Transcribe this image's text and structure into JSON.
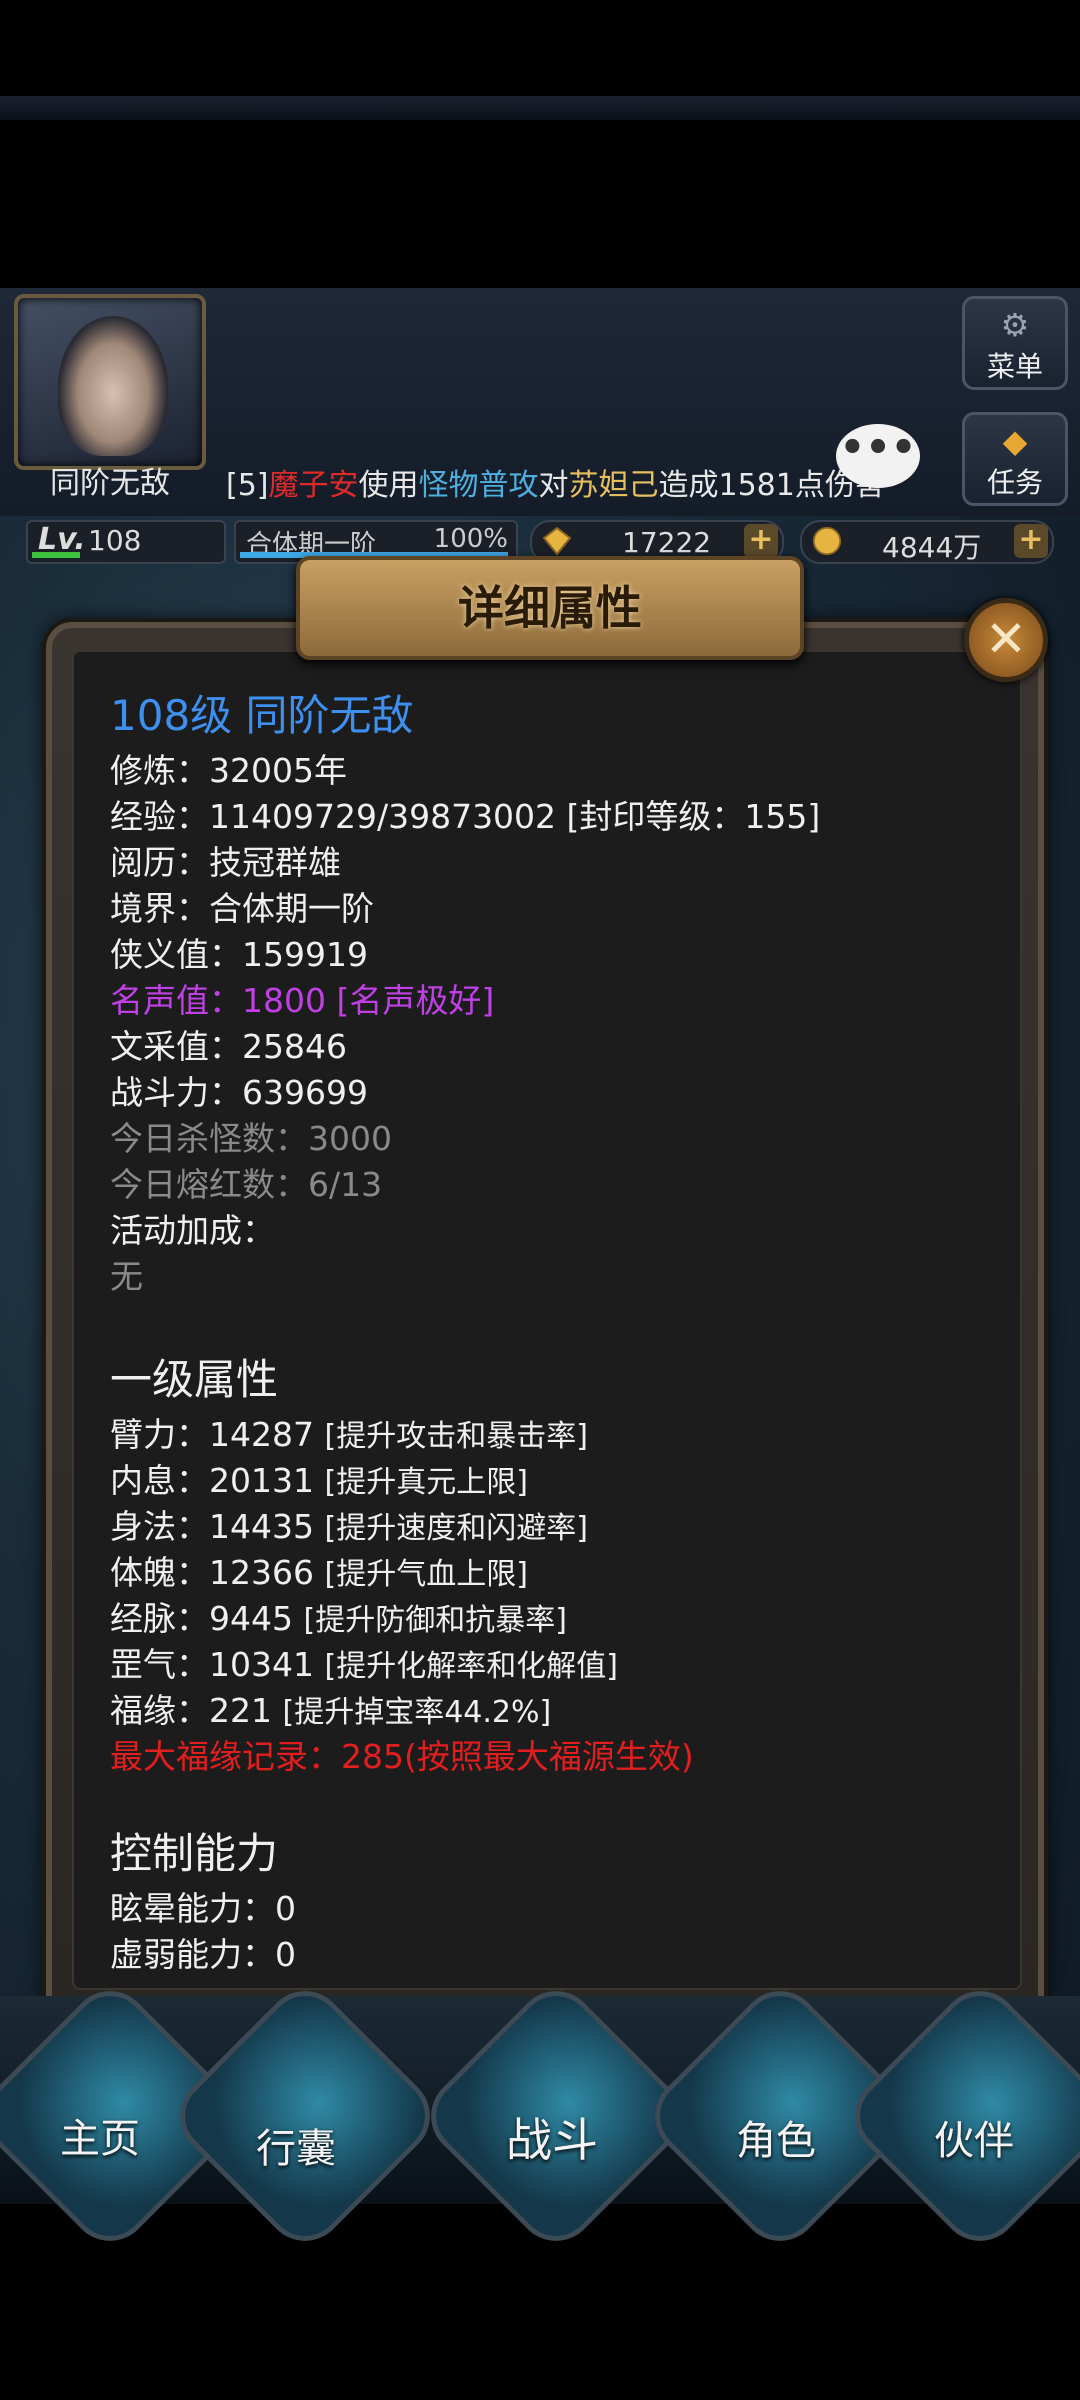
{
  "hud": {
    "hero_name": "同阶无敌",
    "menu_label": "菜单",
    "task_label": "任务",
    "chat": {
      "prefix": "[5]",
      "actor": "魔子安",
      "verb1": "使用",
      "skill": "怪物普攻",
      "verb2": "对",
      "target": "苏妲己",
      "suffix": "造成1581点伤害"
    },
    "bubble": "•••",
    "level_label": "Lv.",
    "level_value": "108",
    "realm_label": "合体期一阶",
    "realm_progress": "100%",
    "ingot_value": "17222",
    "gold_value": "4844万",
    "plus": "+"
  },
  "dialog": {
    "title": "详细属性",
    "close": "✕",
    "header_line": "108级 同阶无敌",
    "lines": [
      "修炼：32005年",
      "经验：11409729/39873002 [封印等级：155]",
      "阅历：技冠群雄",
      "境界：合体期一阶",
      "侠义值：159919",
      "名声值：1800 [名声极好]",
      "文采值：25846",
      "战斗力：639699",
      "今日杀怪数：3000",
      "今日熔红数：6/13",
      "活动加成：",
      "无"
    ],
    "section1_title": "一级属性",
    "attrs": [
      {
        "label": "臂力：14287",
        "hint": "[提升攻击和暴击率]"
      },
      {
        "label": "内息：20131",
        "hint": "[提升真元上限]"
      },
      {
        "label": "身法：14435",
        "hint": "[提升速度和闪避率]"
      },
      {
        "label": "体魄：12366",
        "hint": "[提升气血上限]"
      },
      {
        "label": "经脉：9445",
        "hint": "[提升防御和抗暴率]"
      },
      {
        "label": "罡气：10341",
        "hint": "[提升化解率和化解值]"
      },
      {
        "label": "福缘：221",
        "hint": "[提升掉宝率44.2%]"
      }
    ],
    "fortune_record": "最大福缘记录：285(按照最大福源生效)",
    "section2_title": "控制能力",
    "control": [
      "眩晕能力：0",
      "虚弱能力：0"
    ]
  },
  "nav": {
    "items": [
      "主页",
      "行囊",
      "战斗",
      "角色",
      "伙伴"
    ]
  }
}
